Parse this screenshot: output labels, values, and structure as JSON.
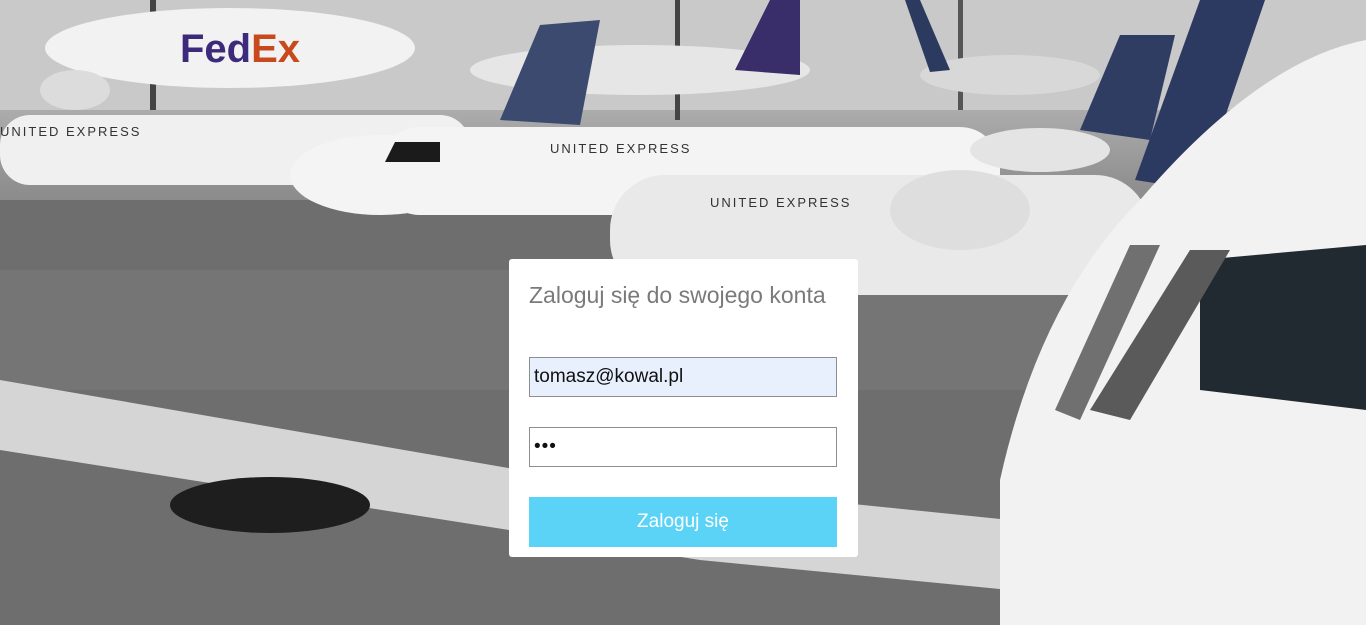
{
  "login": {
    "title": "Zaloguj się do swojego konta",
    "email_value": "tomasz@kowal.pl",
    "password_value": "•••",
    "submit_label": "Zaloguj się"
  },
  "background": {
    "brand_texts": [
      "FedEx",
      "UNITED EXPRESS",
      "UNITED EXPRESS",
      "UNITED EXPRESS"
    ]
  },
  "colors": {
    "accent": "#5bd3f7",
    "title": "#7a7a7a",
    "autofill": "#e8f0fe"
  }
}
